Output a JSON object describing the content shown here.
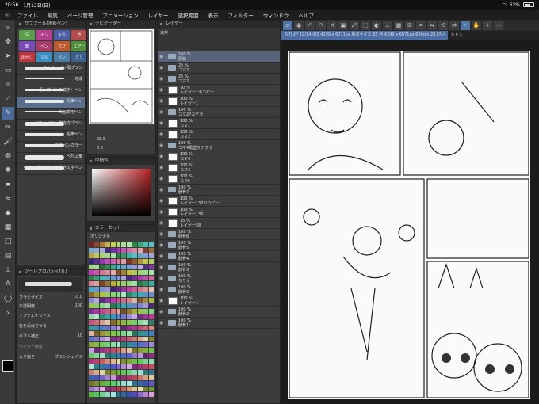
{
  "status": {
    "time": "20:56",
    "date": "1月12日(日)",
    "battery": "62%"
  },
  "menu": [
    "ファイル",
    "編集",
    "ページ管理",
    "アニメーション",
    "レイヤー",
    "選択範囲",
    "表示",
    "フィルター",
    "ウィンドウ",
    "ヘルプ"
  ],
  "panels": {
    "subtool": "サブツール[水彩ペン]",
    "navigator": "ナビゲーター",
    "layer": "レイヤー",
    "colorset": "カラーセット",
    "toolprop": "ツールプロパティ[丸]",
    "colorpicker": "中間色"
  },
  "subtool_tabs": [
    "G",
    "ナン",
    "水彩",
    "草",
    "筆",
    "ペン",
    "カブ",
    "エアー",
    "ぼかし",
    "マル",
    "ペン",
    "ミリ"
  ],
  "brushes": [
    "ミルキーペン風ブラシ",
    "完成",
    "裏っぽ（入り抜き）ペン",
    "丸筆ペン",
    "丸画数用ペン",
    "べちょべちょ描き方ブラシ",
    "鉛筆ペン",
    "丸用ペンカラー",
    "べちょ筆",
    "ちょっぴりえっちな描き文字ペン"
  ],
  "toolprop": {
    "brushsize_label": "ブラシサイズ",
    "brushsize": "10.0",
    "opacity_label": "不透明度",
    "opacity": "100",
    "aa_label": "アンチエイリアス",
    "color_label": "色を近似させる",
    "stabil_label": "手ブレ補正",
    "stabil": "10",
    "vector_label": "ベクター吸着",
    "input_label": "入り抜き",
    "brushshape": "ブラシシェイプ"
  },
  "navigator": {
    "zoom": "28.5",
    "rotate": "0.0"
  },
  "colorset_name": "オリジナル",
  "layer_blend": "通常",
  "layers": [
    {
      "pct": "100 %",
      "mode": "通常",
      "name": "原稿",
      "type": "folder",
      "sel": true
    },
    {
      "pct": "25 %",
      "mode": "通常",
      "name": "コマ2",
      "type": "folder"
    },
    {
      "pct": "25 %",
      "mode": "通常",
      "name": "コマ2",
      "type": "folder"
    },
    {
      "pct": "70 %",
      "mode": "通常",
      "name": "レイヤー1のコピー",
      "type": "layer"
    },
    {
      "pct": "100 %",
      "mode": "通常",
      "name": "レイヤー1",
      "type": "layer"
    },
    {
      "pct": "100 %",
      "mode": "通常",
      "name": "コマ2Pカケラ",
      "type": "folder"
    },
    {
      "pct": "100 %",
      "mode": "通常",
      "name": "コマ1",
      "type": "layer"
    },
    {
      "pct": "100 %",
      "mode": "通常",
      "name": "コマ2",
      "type": "layer"
    },
    {
      "pct": "100 %",
      "mode": "通常",
      "name": "コマ4黒塗りテクラ",
      "type": "folder"
    },
    {
      "pct": "100 %",
      "mode": "通常",
      "name": "コマ4",
      "type": "layer"
    },
    {
      "pct": "100 %",
      "mode": "通常",
      "name": "コマ3",
      "type": "layer"
    },
    {
      "pct": "100 %",
      "mode": "通常",
      "name": "コマ5",
      "type": "layer"
    },
    {
      "pct": "100 %",
      "mode": "通常",
      "name": "骸骨7",
      "type": "folder"
    },
    {
      "pct": "100 %",
      "mode": "通常",
      "name": "レイヤー137のコピー",
      "type": "layer"
    },
    {
      "pct": "100 %",
      "mode": "通常",
      "name": "レイヤー136",
      "type": "layer"
    },
    {
      "pct": "15 %",
      "mode": "通常",
      "name": "レイヤー58",
      "type": "layer"
    },
    {
      "pct": "100 %",
      "mode": "通常",
      "name": "骸骨6",
      "type": "folder"
    },
    {
      "pct": "100 %",
      "mode": "通常",
      "name": "骸骨5",
      "type": "folder"
    },
    {
      "pct": "100 %",
      "mode": "通常",
      "name": "骸骨4",
      "type": "folder"
    },
    {
      "pct": "100 %",
      "mode": "通常",
      "name": "骸骨3",
      "type": "folder"
    },
    {
      "pct": "100 %",
      "mode": "通常",
      "name": "なりえ",
      "type": "folder"
    },
    {
      "pct": "100 %",
      "mode": "通常",
      "name": "骸骨2",
      "type": "folder"
    },
    {
      "pct": "100 %",
      "mode": "通常",
      "name": "レイヤー1",
      "type": "layer"
    },
    {
      "pct": "100 %",
      "mode": "通常",
      "name": "骸骨2",
      "type": "folder"
    },
    {
      "pct": "100 %",
      "mode": "通常",
      "name": "骸骨1",
      "type": "folder"
    }
  ],
  "tabs": [
    "なりえ* 10/14 (B5 4299 x 6071px 製本サイズ:B5 判 4299 x 6071px 600dpi 28.5%)",
    "なりえ"
  ]
}
